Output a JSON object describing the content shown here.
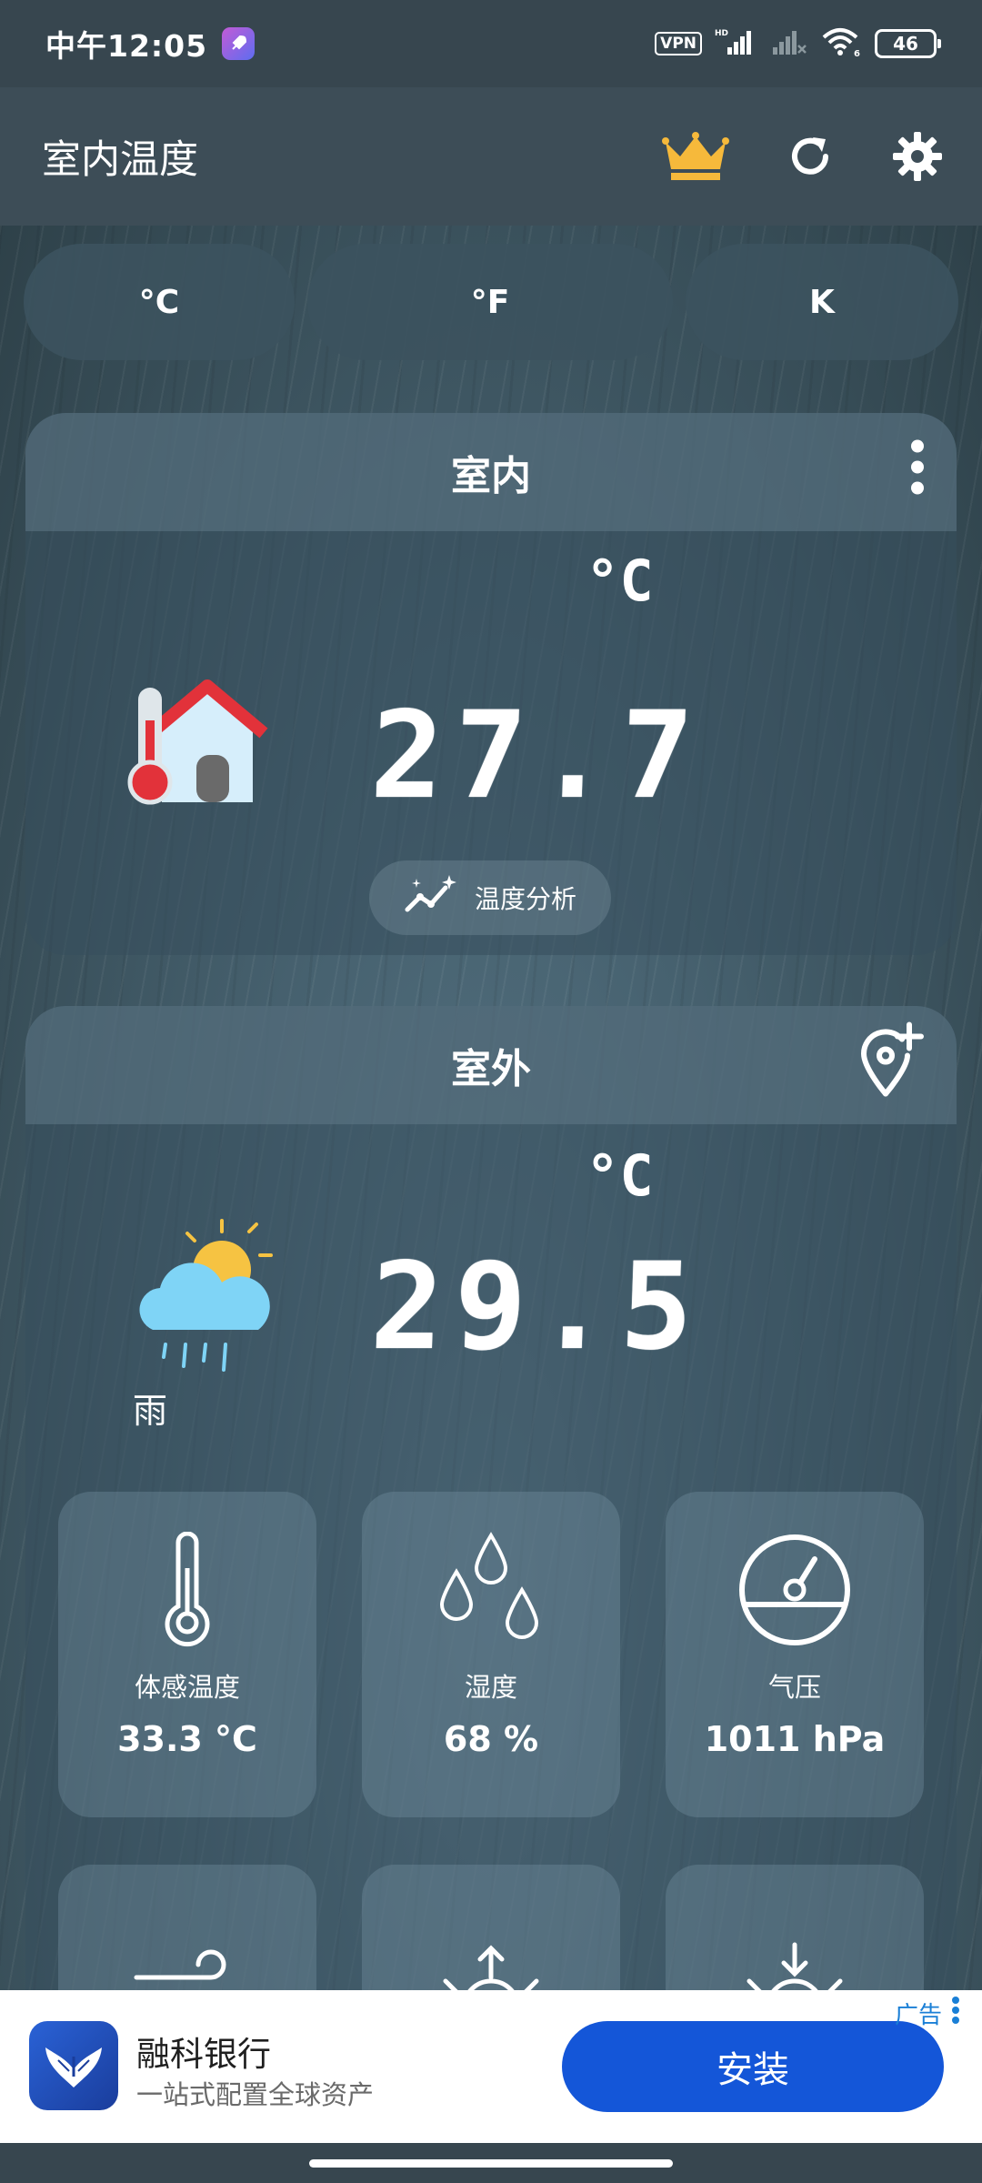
{
  "status_bar": {
    "time": "中午12:05",
    "vpn": "VPN",
    "network": "HD",
    "wifi_tag": "6",
    "battery": "46"
  },
  "app_bar": {
    "title": "室内温度",
    "actions": [
      "crown-icon",
      "refresh-icon",
      "settings-icon"
    ],
    "crown_color": "#f6b93b"
  },
  "units": {
    "c": "°C",
    "f": "°F",
    "k": "K"
  },
  "indoor": {
    "title": "室内",
    "unit": "°C",
    "temperature": "27.7",
    "analysis_label": "温度分析"
  },
  "outdoor": {
    "title": "室外",
    "unit": "°C",
    "temperature": "29.5",
    "weather": "雨",
    "metrics": [
      {
        "label": "体感温度",
        "value": "33.3 °C",
        "icon": "thermometer-icon"
      },
      {
        "label": "湿度",
        "value": "68 %",
        "icon": "humidity-icon"
      },
      {
        "label": "气压",
        "value": "1011 hPa",
        "icon": "pressure-gauge-icon"
      }
    ]
  },
  "ad": {
    "name": "融科银行",
    "description": "一站式配置全球资产",
    "install_label": "安装",
    "tag": "广告",
    "button_color": "#1456d8"
  }
}
